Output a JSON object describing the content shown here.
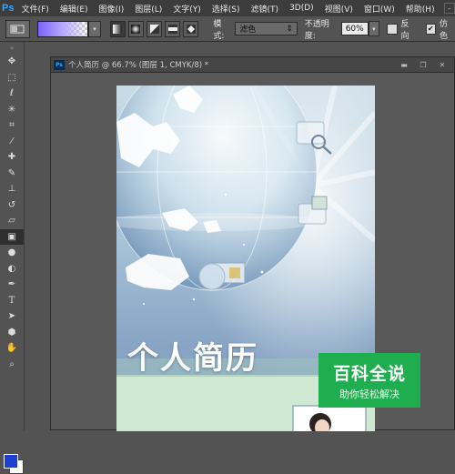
{
  "app": {
    "logo": "Ps"
  },
  "menu": {
    "items": [
      "文件(F)",
      "编辑(E)",
      "图像(I)",
      "图层(L)",
      "文字(Y)",
      "选择(S)",
      "滤镜(T)",
      "3D(D)",
      "视图(V)",
      "窗口(W)",
      "帮助(H)"
    ]
  },
  "options": {
    "mode_label": "模式:",
    "mode_value": "滤色",
    "opacity_label": "不透明度:",
    "opacity_value": "60%",
    "reverse_label": "反向",
    "dither_label": "仿色",
    "dither_checked": true,
    "reverse_checked": false
  },
  "document": {
    "title": "个人简历 @ 66.7% (图层 1, CMYK/8) *"
  },
  "canvas": {
    "heading": "个人简历"
  },
  "watermark": {
    "main": "百科全说",
    "sub": "助你轻松解决"
  },
  "colors": {
    "foreground": "#1d3fd0",
    "background": "#ffffff",
    "watermark_green": "#1fae4f"
  },
  "tools": [
    "move-tool",
    "marquee-tool",
    "lasso-tool",
    "magic-wand-tool",
    "crop-tool",
    "eyedropper-tool",
    "healing-brush-tool",
    "brush-tool",
    "clone-stamp-tool",
    "history-brush-tool",
    "eraser-tool",
    "gradient-tool",
    "blur-tool",
    "dodge-tool",
    "pen-tool",
    "type-tool",
    "path-selection-tool",
    "shape-tool",
    "hand-tool",
    "zoom-tool"
  ]
}
